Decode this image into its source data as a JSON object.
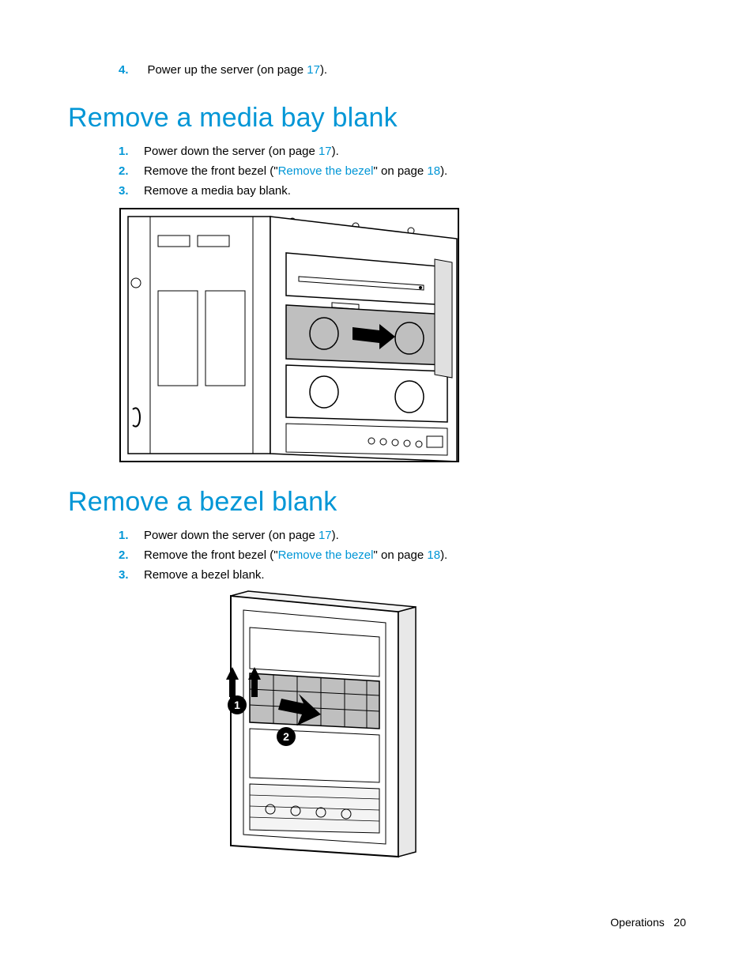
{
  "top_step": {
    "number": "4.",
    "prefix": "Power up the server (on page ",
    "page_link": "17",
    "suffix": ")."
  },
  "section1": {
    "heading": "Remove a media bay blank",
    "steps": [
      {
        "n": "1.",
        "prefix": "Power down the server (on page ",
        "link": "17",
        "suffix": ")."
      },
      {
        "n": "2.",
        "prefix": "Remove the front bezel (\"",
        "link": "Remove the bezel",
        "mid": "\" on page ",
        "link2": "18",
        "suffix": ")."
      },
      {
        "n": "3.",
        "prefix": "Remove a media bay blank."
      }
    ]
  },
  "section2": {
    "heading": "Remove a bezel blank",
    "steps": [
      {
        "n": "1.",
        "prefix": "Power down the server (on page ",
        "link": "17",
        "suffix": ")."
      },
      {
        "n": "2.",
        "prefix": "Remove the front bezel (\"",
        "link": "Remove the bezel",
        "mid": "\" on page ",
        "link2": "18",
        "suffix": ")."
      },
      {
        "n": "3.",
        "prefix": "Remove a bezel blank."
      }
    ]
  },
  "footer": {
    "section": "Operations",
    "page": "20"
  }
}
